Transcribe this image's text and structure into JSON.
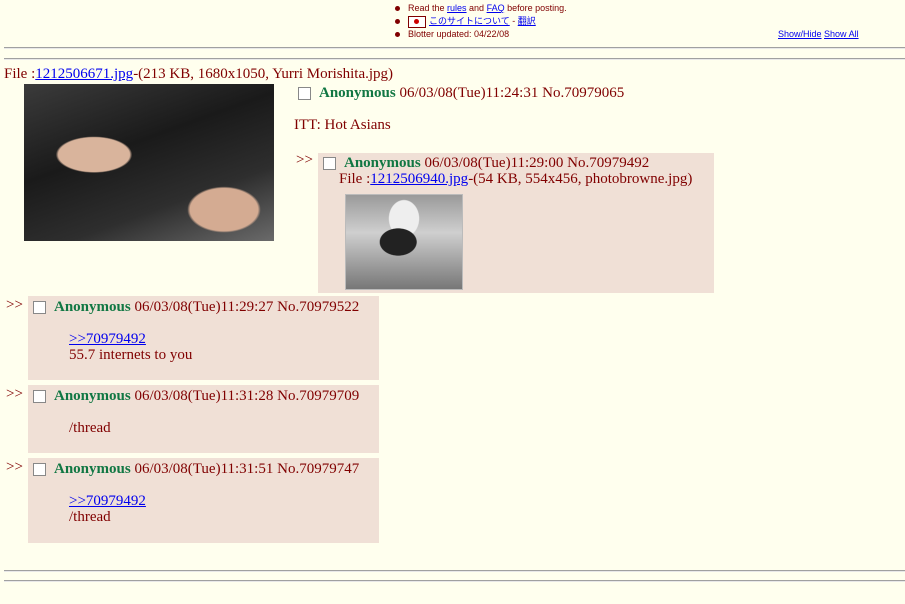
{
  "notices": {
    "rules_line": {
      "pre": "Read the ",
      "rules": "rules",
      "mid": " and ",
      "faq": "FAQ",
      "post": " before posting."
    },
    "site_line": {
      "link": "このサイトについて",
      "sep": " - ",
      "translate": "翻訳"
    },
    "blotter": "Blotter updated: 04/22/08",
    "show_hide": "Show/Hide",
    "show_all": "Show All"
  },
  "op": {
    "file_prefix": "File :",
    "file_name": "1212506671.jpg",
    "file_info": "-(213 KB, 1680x1050, Yurri Morishita.jpg)",
    "name": "Anonymous",
    "datetime": "06/03/08(Tue)11:24:31",
    "no": "No.70979065",
    "comment": "ITT: Hot Asians"
  },
  "replies": [
    {
      "arrows": ">>",
      "name": "Anonymous",
      "datetime": "06/03/08(Tue)11:29:00",
      "no": "No.70979492",
      "file_prefix": "File :",
      "file_name": "1212506940.jpg",
      "file_info": "-(54 KB, 554x456, photobrowne.jpg)"
    },
    {
      "arrows": ">>",
      "name": "Anonymous",
      "datetime": "06/03/08(Tue)11:29:27",
      "no": "No.70979522",
      "quote": ">>70979492",
      "comment": "55.7 internets to you"
    },
    {
      "arrows": ">>",
      "name": "Anonymous",
      "datetime": "06/03/08(Tue)11:31:28",
      "no": "No.70979709",
      "comment": "/thread"
    },
    {
      "arrows": ">>",
      "name": "Anonymous",
      "datetime": "06/03/08(Tue)11:31:51",
      "no": "No.70979747",
      "quote": ">>70979492",
      "comment": "/thread"
    }
  ]
}
